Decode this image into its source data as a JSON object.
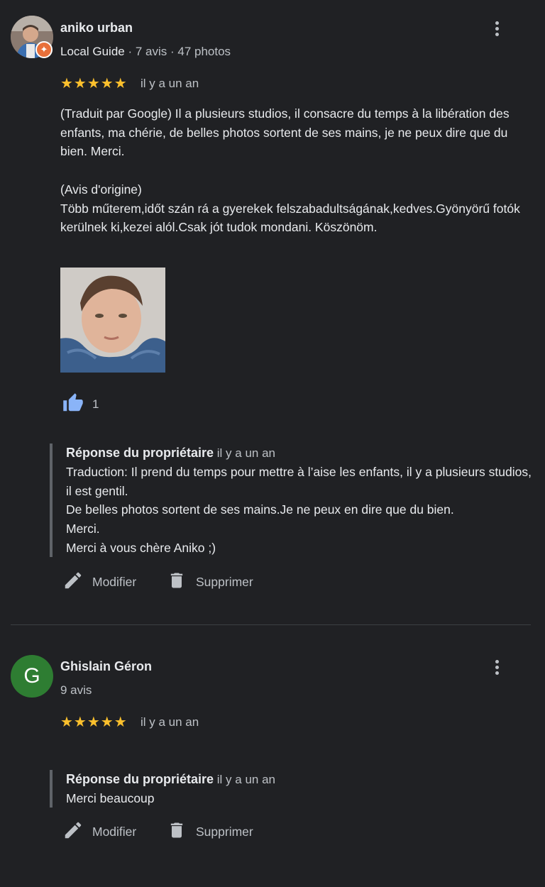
{
  "reviews": [
    {
      "name": "aniko urban",
      "avatar_badge": "✦",
      "meta_guide": "Local Guide",
      "meta_rest": " · 7 avis · 47 photos",
      "stars": "★★★★★",
      "date": "il y a un an",
      "text": "(Traduit par Google) Il a plusieurs studios, il consacre du temps à la libération des enfants, ma chérie, de belles photos sortent de ses mains, je ne peux dire que du bien. Merci.\n\n(Avis d'origine)\nTöbb műterem,időt szán rá a gyerekek felszabadultságának,kedves.Gyönyörű fotók kerülnek ki,kezei alól.Csak jót tudok mondani. Köszönöm.",
      "likes": "1",
      "reply_label": "Réponse du propriétaire",
      "reply_date": "il y a un an",
      "reply_text": "Traduction: Il prend du temps pour mettre à l’aise les enfants, il y a plusieurs studios, il est gentil.\nDe belles photos sortent de ses mains.Je ne peux en dire que du bien.\nMerci.\nMerci à vous chère Aniko ;)",
      "edit_label": "Modifier",
      "delete_label": "Supprimer"
    },
    {
      "name": "Ghislain Géron",
      "avatar_letter": "G",
      "meta": "9 avis",
      "stars": "★★★★★",
      "date": "il y a un an",
      "reply_label": "Réponse du propriétaire",
      "reply_date": "il y a un an",
      "reply_text": "Merci beaucoup",
      "edit_label": "Modifier",
      "delete_label": "Supprimer"
    }
  ],
  "colors": {
    "background": "#202124",
    "star": "#fbc02d",
    "like": "#8ab4f8",
    "avatar_green": "#2e7d32",
    "guide_badge": "#e8703a"
  },
  "icons": [
    "more-vert-icon",
    "thumb-up-icon",
    "edit-icon",
    "delete-icon",
    "local-guide-badge-icon"
  ]
}
